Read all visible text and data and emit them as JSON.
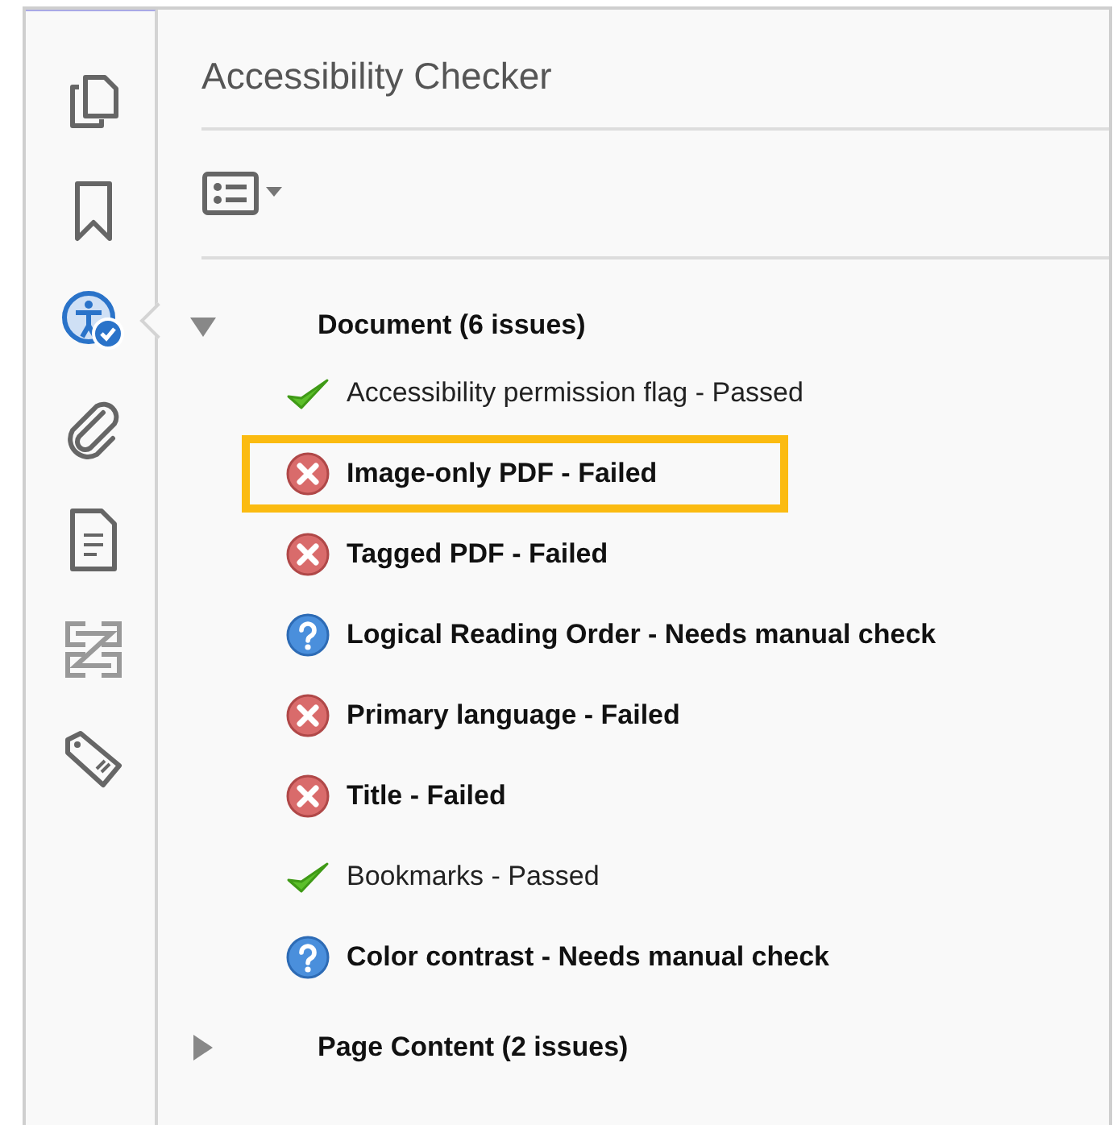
{
  "sidebar": {
    "items": [
      {
        "kind": "pages",
        "selected": false
      },
      {
        "kind": "bookmark",
        "selected": false
      },
      {
        "kind": "accessibility",
        "selected": true
      },
      {
        "kind": "attachment",
        "selected": false
      },
      {
        "kind": "document",
        "selected": false
      },
      {
        "kind": "compare",
        "selected": false
      },
      {
        "kind": "tag",
        "selected": false
      }
    ]
  },
  "panel": {
    "title": "Accessibility Checker",
    "groups": [
      {
        "label": "Document (6 issues)",
        "expanded": true,
        "children": [
          {
            "label": "Accessibility permission flag - Passed",
            "kind": "passed",
            "highlighted": false
          },
          {
            "label": "Image-only PDF - Failed",
            "kind": "failed",
            "highlighted": true
          },
          {
            "label": "Tagged PDF - Failed",
            "kind": "failed",
            "highlighted": false
          },
          {
            "label": "Logical Reading Order - Needs manual check",
            "kind": "manual",
            "highlighted": false
          },
          {
            "label": "Primary language - Failed",
            "kind": "failed",
            "highlighted": false
          },
          {
            "label": "Title - Failed",
            "kind": "failed",
            "highlighted": false
          },
          {
            "label": "Bookmarks - Passed",
            "kind": "passed",
            "highlighted": false
          },
          {
            "label": "Color contrast - Needs manual check",
            "kind": "manual",
            "highlighted": false
          }
        ]
      },
      {
        "label": "Page Content (2 issues)",
        "expanded": false
      }
    ]
  }
}
